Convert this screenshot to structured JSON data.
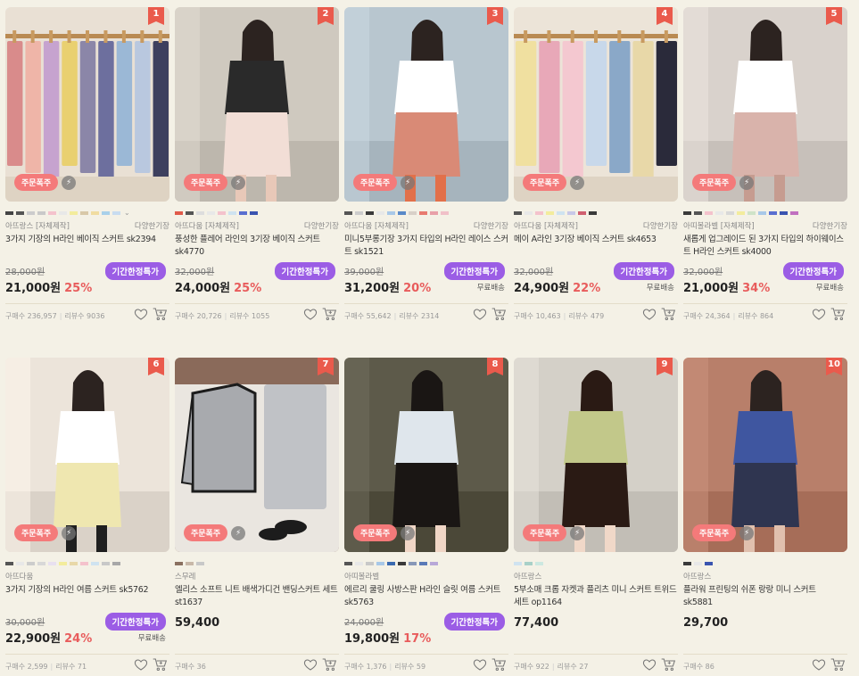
{
  "products": [
    {
      "rank": "1",
      "brand": "아뜨랑스 [자체제작]",
      "length": "다양한기장",
      "title": "3가지 기장의 H라인 베이직 스커트 sk2394",
      "orig": "28,000원",
      "price": "21,000원",
      "pct": "25%",
      "sale": "기간한정특가",
      "ship": "",
      "buy": "구매수 236,957",
      "rev": "리뷰수 9036",
      "order_badge": "주문폭주",
      "bolt": true,
      "colors": [
        "#444444",
        "#555555",
        "#cccccc",
        "#c9c9c9",
        "#f4c2cc",
        "#e8e8e8",
        "#f3ec9c",
        "#d8c8a8",
        "#f0dca0",
        "#a8d0ea",
        "#c8dcf0"
      ],
      "more": true,
      "img": {
        "bg": "#e9e0d4",
        "accents": [
          "#d98b8b",
          "#efb5a8",
          "#c6a3cf",
          "#e9d070",
          "#8b86a8",
          "#6d6f9e",
          "#9bb8d6",
          "#b9c8df",
          "#3d3f5e"
        ],
        "type": "rack"
      }
    },
    {
      "rank": "2",
      "brand": "아뜨다움 [자체제작]",
      "length": "다양한기장",
      "title": "풍성한 플레어 라인의 3기장 베이직 스커트 sk4770",
      "orig": "32,000원",
      "price": "24,000원",
      "pct": "25%",
      "sale": "기간한정특가",
      "ship": "",
      "buy": "구매수 20,726",
      "rev": "리뷰수 1055",
      "order_badge": "주문폭주",
      "bolt": true,
      "colors": [
        "#e05a4a",
        "#555555",
        "#dddddd",
        "#e8e8e8",
        "#f4c2cc",
        "#cfe3f0",
        "#5a6fd0",
        "#3a54b0"
      ],
      "more": false,
      "img": {
        "bg": "#cfc9bf",
        "accents": [
          "#2a2a2a",
          "#f2ded6",
          "#e8c8b8",
          "#8a7a6a"
        ],
        "type": "model"
      }
    },
    {
      "rank": "3",
      "brand": "아뜨다움 [자체제작]",
      "length": "다양한기장",
      "title": "미니5부롱기장 3가지 타입의 H라인 레이스 스커트 sk1521",
      "orig": "39,000원",
      "price": "31,200원",
      "pct": "20%",
      "sale": "기간한정특가",
      "ship": "무료배송",
      "buy": "구매수 55,642",
      "rev": "리뷰수 2314",
      "order_badge": "주문폭주",
      "bolt": true,
      "colors": [
        "#555555",
        "#cccccc",
        "#3a3a3a",
        "#e8e8e8",
        "#a8c8e8",
        "#5a8ac8",
        "#d8d0c8",
        "#e87a70",
        "#e8a0a8",
        "#f0c0c8"
      ],
      "more": false,
      "img": {
        "bg": "#b8c6cf",
        "accents": [
          "#ffffff",
          "#d98a76",
          "#e2704a",
          "#7a8f5a"
        ],
        "type": "model"
      }
    },
    {
      "rank": "4",
      "brand": "아뜨다움 [자체제작]",
      "length": "다양한기장",
      "title": "메이 A라인 3기장 베이직 스커트 sk4653",
      "orig": "32,000원",
      "price": "24,900원",
      "pct": "22%",
      "sale": "기간한정특가",
      "ship": "무료배송",
      "buy": "구매수 10,463",
      "rev": "리뷰수 479",
      "order_badge": "주문폭주",
      "bolt": true,
      "colors": [
        "#555555",
        "#e8e8e8",
        "#f4c2cc",
        "#f3ec9c",
        "#cfe3f0",
        "#c8c8e8",
        "#d06070",
        "#3a3a3a"
      ],
      "more": false,
      "img": {
        "bg": "#ece4d8",
        "accents": [
          "#f0e0a0",
          "#e8a8b8",
          "#f4c8d0",
          "#c8d8ea",
          "#8aa8c8",
          "#e8d8a8",
          "#2a2a3a"
        ],
        "type": "rack"
      }
    },
    {
      "rank": "5",
      "brand": "아띠볼라벨 [자체제작]",
      "length": "다양한기장",
      "title": "새롭게 업그레이드 된 3가지 타입의 하이웨이스트 H라인 스커트 sk4000",
      "orig": "32,000원",
      "price": "21,000원",
      "pct": "34%",
      "sale": "기간한정특가",
      "ship": "무료배송",
      "buy": "구매수 24,364",
      "rev": "리뷰수 864",
      "order_badge": "주문폭주",
      "bolt": true,
      "colors": [
        "#3a3a3a",
        "#555555",
        "#f4c2cc",
        "#e8e8e8",
        "#d8d8d8",
        "#f3ec9c",
        "#cfe3c8",
        "#a8c8e8",
        "#5a6fd0",
        "#3a54b0",
        "#c070c0"
      ],
      "more": false,
      "img": {
        "bg": "#d9d2cc",
        "accents": [
          "#ffffff",
          "#d9b3ab",
          "#c69c90",
          "#9aa5b0"
        ],
        "type": "model"
      }
    },
    {
      "rank": "6",
      "brand": "아뜨다움",
      "length": "",
      "title": "3가지 기장의 H라인 여름 스커트 sk5762",
      "orig": "30,000원",
      "price": "22,900원",
      "pct": "24%",
      "sale": "기간한정특가",
      "ship": "무료배송",
      "buy": "구매수 2,599",
      "rev": "리뷰수 71",
      "order_badge": "주문폭주",
      "bolt": true,
      "colors": [
        "#555555",
        "#e8e8e8",
        "#cccccc",
        "#d8d8d8",
        "#e8e0f0",
        "#f3ec9c",
        "#e8d8a8",
        "#f4c2cc",
        "#cfe3f0",
        "#c8c8c8",
        "#a8a8a8"
      ],
      "more": false,
      "img": {
        "bg": "#ece4da",
        "accents": [
          "#ffffff",
          "#efe7b0",
          "#1f1f1f",
          "#d8c8b8"
        ],
        "type": "model"
      }
    },
    {
      "rank": "7",
      "brand": "스무레",
      "length": "",
      "title": "엘리스 소프트 니트 배색가디건 밴딩스커트 세트 st1637",
      "orig": "",
      "price": "59,400",
      "pct": "",
      "sale": "",
      "ship": "",
      "buy": "구매수 36",
      "rev": "",
      "order_badge": "주문폭주",
      "bolt": true,
      "colors": [
        "#8a7060",
        "#c8b8a8",
        "#c8c8c8"
      ],
      "more": false,
      "img": {
        "bg": "#8a6a5a",
        "accents": [
          "#a8aaae",
          "#1c1c1c",
          "#c0c2c6",
          "#eae6e0"
        ],
        "type": "set"
      }
    },
    {
      "rank": "8",
      "brand": "아띠볼라벨",
      "length": "",
      "title": "에르리 쿨링 사방스판 H라인 슬릿 여름 스커트 sk5763",
      "orig": "24,000원",
      "price": "19,800원",
      "pct": "17%",
      "sale": "기간한정특가",
      "ship": "",
      "buy": "구매수 1,376",
      "rev": "리뷰수 59",
      "order_badge": "주문폭주",
      "bolt": true,
      "colors": [
        "#555555",
        "#e8e8e8",
        "#c8c8c8",
        "#a8c8e8",
        "#3a6ab0",
        "#3a3a3a",
        "#8898b8",
        "#5a7ab8",
        "#b8a8d8"
      ],
      "more": false,
      "img": {
        "bg": "#5d5a4a",
        "accents": [
          "#dfe6ec",
          "#1a1614",
          "#f0d6c6",
          "#7a8a5a"
        ],
        "type": "model"
      }
    },
    {
      "rank": "9",
      "brand": "아뜨랑스",
      "length": "",
      "title": "5부소매 크롭 자켓과 플리츠 미니 스커트 트위드 세트 op1164",
      "orig": "",
      "price": "77,400",
      "pct": "",
      "sale": "",
      "ship": "",
      "buy": "구매수 922",
      "rev": "리뷰수 27",
      "order_badge": "주문폭주",
      "bolt": true,
      "colors": [
        "#cfe3f0",
        "#a8d0c8",
        "#cce8e0"
      ],
      "more": false,
      "img": {
        "bg": "#d4d0c8",
        "accents": [
          "#c2c88a",
          "#2a1a14",
          "#f0d8c8",
          "#e8e4dc"
        ],
        "type": "model"
      }
    },
    {
      "rank": "10",
      "brand": "아뜨랑스",
      "length": "",
      "title": "플라워 프린팅의 쉬폰 랑랑 미니 스커트 sk5881",
      "orig": "",
      "price": "29,700",
      "pct": "",
      "sale": "",
      "ship": "",
      "buy": "구매수 86",
      "rev": "",
      "order_badge": "주문폭주",
      "bolt": true,
      "colors": [
        "#3a3a3a",
        "#e8e8e8",
        "#3a54b0"
      ],
      "more": false,
      "img": {
        "bg": "#b87f6a",
        "accents": [
          "#3f56a0",
          "#2f3550",
          "#e0c0ae",
          "#1f1f1f"
        ],
        "type": "model"
      }
    }
  ]
}
